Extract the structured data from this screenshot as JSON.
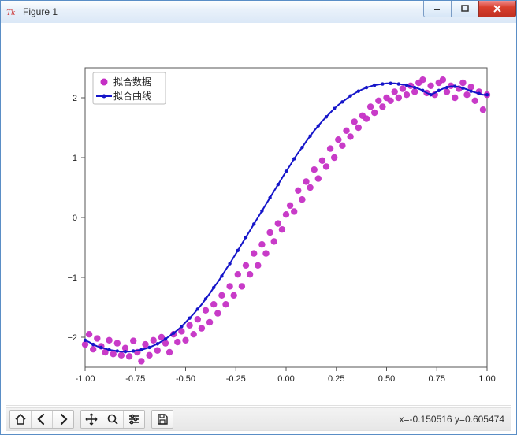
{
  "window": {
    "title": "Figure 1",
    "tk_label": "Tk",
    "coord_text": "x=-0.150516   y=0.605474"
  },
  "legend": {
    "scatter_label": "拟合数据",
    "line_label": "拟合曲线"
  },
  "toolbar": {
    "home": "Home",
    "back": "Back",
    "forward": "Forward",
    "pan": "Pan",
    "zoom": "Zoom",
    "configure": "Configure subplots",
    "save": "Save"
  },
  "chart_data": {
    "type": "scatter+line",
    "xlabel": "",
    "ylabel": "",
    "xlim": [
      -1.0,
      1.0
    ],
    "ylim": [
      -2.5,
      2.5
    ],
    "xticks": [
      -1.0,
      -0.75,
      -0.5,
      -0.25,
      0.0,
      0.25,
      0.5,
      0.75,
      1.0
    ],
    "yticks": [
      -2,
      -1,
      0,
      1,
      2
    ],
    "series": [
      {
        "name": "拟合数据",
        "type": "scatter",
        "color": "#c530c5",
        "x": [
          -1.0,
          -0.98,
          -0.96,
          -0.94,
          -0.92,
          -0.9,
          -0.88,
          -0.86,
          -0.84,
          -0.82,
          -0.8,
          -0.78,
          -0.76,
          -0.74,
          -0.72,
          -0.7,
          -0.68,
          -0.66,
          -0.64,
          -0.62,
          -0.6,
          -0.58,
          -0.56,
          -0.54,
          -0.52,
          -0.5,
          -0.48,
          -0.46,
          -0.44,
          -0.42,
          -0.4,
          -0.38,
          -0.36,
          -0.34,
          -0.32,
          -0.3,
          -0.28,
          -0.26,
          -0.24,
          -0.22,
          -0.2,
          -0.18,
          -0.16,
          -0.14,
          -0.12,
          -0.1,
          -0.08,
          -0.06,
          -0.04,
          -0.02,
          0.0,
          0.02,
          0.04,
          0.06,
          0.08,
          0.1,
          0.12,
          0.14,
          0.16,
          0.18,
          0.2,
          0.22,
          0.24,
          0.26,
          0.28,
          0.3,
          0.32,
          0.34,
          0.36,
          0.38,
          0.4,
          0.42,
          0.44,
          0.46,
          0.48,
          0.5,
          0.52,
          0.54,
          0.56,
          0.58,
          0.6,
          0.62,
          0.64,
          0.66,
          0.68,
          0.7,
          0.72,
          0.74,
          0.76,
          0.78,
          0.8,
          0.82,
          0.84,
          0.86,
          0.88,
          0.9,
          0.92,
          0.94,
          0.96,
          0.98,
          1.0
        ],
        "y": [
          -2.12,
          -1.95,
          -2.2,
          -2.02,
          -2.15,
          -2.25,
          -2.05,
          -2.28,
          -2.1,
          -2.3,
          -2.18,
          -2.32,
          -2.06,
          -2.25,
          -2.4,
          -2.12,
          -2.3,
          -2.05,
          -2.22,
          -2.0,
          -2.1,
          -2.25,
          -1.95,
          -2.08,
          -1.9,
          -2.05,
          -1.8,
          -1.95,
          -1.7,
          -1.85,
          -1.55,
          -1.75,
          -1.45,
          -1.6,
          -1.3,
          -1.45,
          -1.15,
          -1.3,
          -0.95,
          -1.15,
          -0.8,
          -0.95,
          -0.6,
          -0.8,
          -0.45,
          -0.6,
          -0.25,
          -0.4,
          -0.1,
          -0.2,
          0.05,
          0.2,
          0.1,
          0.45,
          0.3,
          0.6,
          0.5,
          0.8,
          0.65,
          0.95,
          0.85,
          1.15,
          1.0,
          1.3,
          1.2,
          1.45,
          1.35,
          1.6,
          1.5,
          1.7,
          1.65,
          1.85,
          1.75,
          1.95,
          1.85,
          2.0,
          1.95,
          2.1,
          2.0,
          2.15,
          2.05,
          2.2,
          2.1,
          2.25,
          2.3,
          2.08,
          2.2,
          2.05,
          2.25,
          2.3,
          2.1,
          2.2,
          2.0,
          2.15,
          2.25,
          2.05,
          2.18,
          1.95,
          2.1,
          1.8,
          2.05
        ]
      },
      {
        "name": "拟合曲线",
        "type": "line",
        "color": "#1515c9",
        "x": [
          -1.0,
          -0.98,
          -0.96,
          -0.94,
          -0.92,
          -0.9,
          -0.88,
          -0.86,
          -0.84,
          -0.82,
          -0.8,
          -0.78,
          -0.76,
          -0.74,
          -0.72,
          -0.7,
          -0.68,
          -0.66,
          -0.64,
          -0.62,
          -0.6,
          -0.58,
          -0.56,
          -0.54,
          -0.52,
          -0.5,
          -0.48,
          -0.46,
          -0.44,
          -0.42,
          -0.4,
          -0.38,
          -0.36,
          -0.34,
          -0.32,
          -0.3,
          -0.28,
          -0.26,
          -0.24,
          -0.22,
          -0.2,
          -0.18,
          -0.16,
          -0.14,
          -0.12,
          -0.1,
          -0.08,
          -0.06,
          -0.04,
          -0.02,
          0.0,
          0.02,
          0.04,
          0.06,
          0.08,
          0.1,
          0.12,
          0.14,
          0.16,
          0.18,
          0.2,
          0.22,
          0.24,
          0.26,
          0.28,
          0.3,
          0.32,
          0.34,
          0.36,
          0.38,
          0.4,
          0.42,
          0.44,
          0.46,
          0.48,
          0.5,
          0.52,
          0.54,
          0.56,
          0.58,
          0.6,
          0.62,
          0.64,
          0.66,
          0.68,
          0.7,
          0.72,
          0.74,
          0.76,
          0.78,
          0.8,
          0.82,
          0.84,
          0.86,
          0.88,
          0.9,
          0.92,
          0.94,
          0.96,
          0.98,
          1.0
        ],
        "y": [
          -2.05,
          -2.08,
          -2.12,
          -2.15,
          -2.17,
          -2.19,
          -2.21,
          -2.22,
          -2.23,
          -2.24,
          -2.24,
          -2.24,
          -2.23,
          -2.22,
          -2.21,
          -2.19,
          -2.17,
          -2.14,
          -2.11,
          -2.07,
          -2.03,
          -1.98,
          -1.93,
          -1.88,
          -1.82,
          -1.75,
          -1.68,
          -1.61,
          -1.53,
          -1.45,
          -1.36,
          -1.27,
          -1.17,
          -1.08,
          -0.98,
          -0.87,
          -0.77,
          -0.66,
          -0.55,
          -0.44,
          -0.33,
          -0.22,
          -0.11,
          0.0,
          0.11,
          0.22,
          0.33,
          0.44,
          0.55,
          0.66,
          0.77,
          0.87,
          0.98,
          1.08,
          1.17,
          1.27,
          1.36,
          1.45,
          1.53,
          1.61,
          1.68,
          1.75,
          1.82,
          1.88,
          1.93,
          1.98,
          2.03,
          2.07,
          2.11,
          2.14,
          2.17,
          2.19,
          2.21,
          2.22,
          2.23,
          2.24,
          2.24,
          2.24,
          2.23,
          2.22,
          2.21,
          2.19,
          2.17,
          2.15,
          2.12,
          2.08,
          2.05,
          2.08,
          2.12,
          2.15,
          2.17,
          2.19,
          2.19,
          2.18,
          2.16,
          2.14,
          2.11,
          2.09,
          2.07,
          2.05,
          2.05
        ]
      }
    ]
  }
}
